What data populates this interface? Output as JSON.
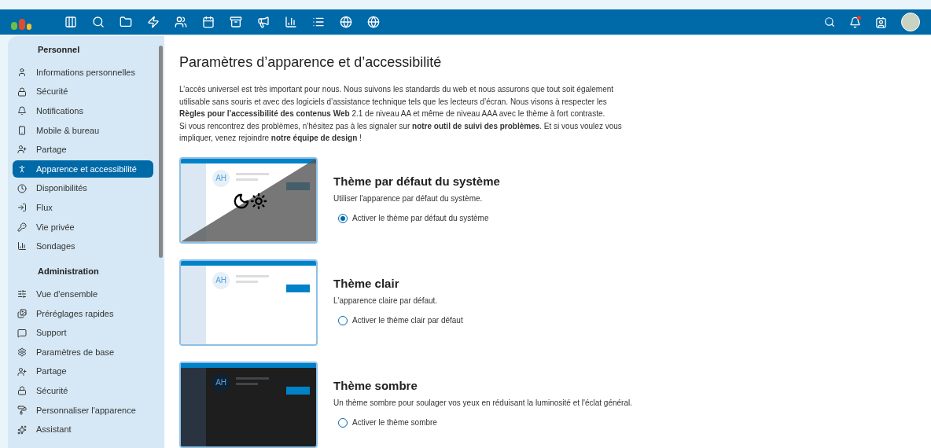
{
  "sidebar": {
    "sections": [
      {
        "title": "Personnel",
        "items": [
          {
            "label": "Informations personnelles",
            "selected": false
          },
          {
            "label": "Sécurité",
            "selected": false
          },
          {
            "label": "Notifications",
            "selected": false
          },
          {
            "label": "Mobile & bureau",
            "selected": false
          },
          {
            "label": "Partage",
            "selected": false
          },
          {
            "label": "Apparence et accessibilité",
            "selected": true
          },
          {
            "label": "Disponibilités",
            "selected": false
          },
          {
            "label": "Flux",
            "selected": false
          },
          {
            "label": "Vie privée",
            "selected": false
          },
          {
            "label": "Sondages",
            "selected": false
          }
        ]
      },
      {
        "title": "Administration",
        "items": [
          {
            "label": "Vue d'ensemble",
            "selected": false
          },
          {
            "label": "Préréglages rapides",
            "selected": false
          },
          {
            "label": "Support",
            "selected": false
          },
          {
            "label": "Paramètres de base",
            "selected": false
          },
          {
            "label": "Partage",
            "selected": false
          },
          {
            "label": "Sécurité",
            "selected": false
          },
          {
            "label": "Personnaliser l'apparence",
            "selected": false
          },
          {
            "label": "Assistant",
            "selected": false
          }
        ]
      }
    ]
  },
  "main": {
    "title": "Paramètres d’apparence et d’accessibilité",
    "paragraphs": [
      "L’accès universel est très important pour nous. Nous suivons les standards du web et nous assurons que tout soit également utilisable sans souris et avec des logiciels d’assistance technique tels que les lecteurs d’écran. Nous visons à respecter les **Règles pour l’accessibilité des contenus Web** 2.1 de niveau AA et même de niveau AAA avec le thème à fort contraste.",
      "Si vous rencontrez des problèmes, n'hésitez pas à les signaler sur **notre outil de suivi des problèmes**. Et si vous voulez vous impliquer, venez rejoindre **notre équipe de design** !"
    ],
    "themes": [
      {
        "kind": "system",
        "preview_avatar": "AH",
        "title": "Thème par défaut du système",
        "description": "Utiliser l'apparence par défaut du système.",
        "option": "Activer le thème par défaut du système",
        "selected": true
      },
      {
        "kind": "light",
        "preview_avatar": "AH",
        "title": "Thème clair",
        "description": "L'apparence claire par défaut.",
        "option": "Activer le thème clair par défaut",
        "selected": false
      },
      {
        "kind": "dark",
        "preview_avatar": "AH",
        "title": "Thème sombre",
        "description": "Un thème sombre pour soulager vos yeux en réduisant la luminosité et l'éclat général.",
        "option": "Activer le thème sombre",
        "selected": false
      }
    ]
  }
}
